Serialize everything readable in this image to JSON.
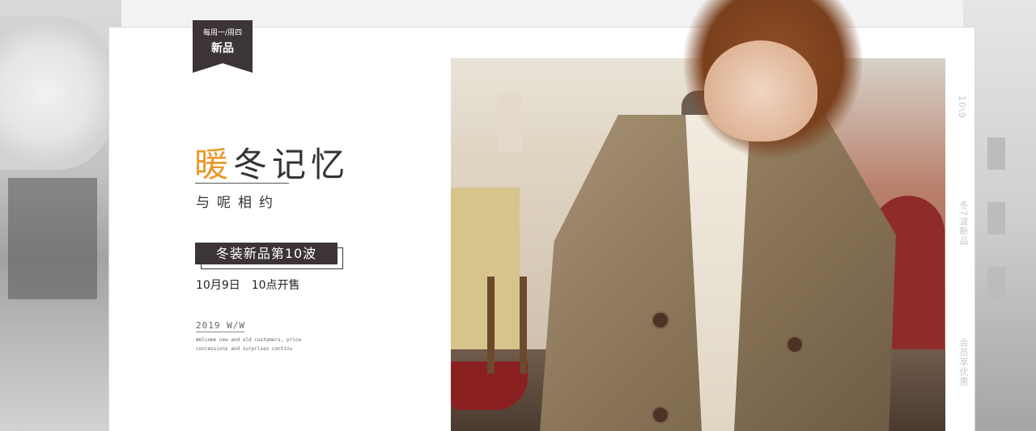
{
  "badge": {
    "schedule": "每周一/周四",
    "label": "新品"
  },
  "headline": {
    "accent": "暖",
    "rest": "冬记忆"
  },
  "subtitle": "与呢相约",
  "promo": {
    "wave": "冬装新品第10波",
    "date": "10月9日",
    "time": "10点开售"
  },
  "season": "2019 W/W",
  "welcome_text": "Welcome new and old customers, price concessions and surprises continu",
  "side_text": {
    "date": "10\\9",
    "wave": "冬7波新品",
    "member": "会员享优惠"
  },
  "colors": {
    "accent": "#e99a2a",
    "dark_box": "#3d3535"
  }
}
